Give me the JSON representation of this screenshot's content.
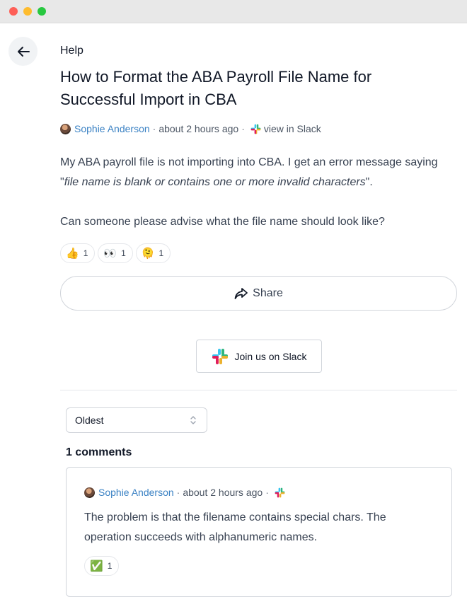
{
  "breadcrumb": "Help",
  "post": {
    "title": "How to Format the ABA Payroll File Name for Successful Import in CBA",
    "author": "Sophie Anderson",
    "separator": "·",
    "time": "about 2 hours ago",
    "slack_link": "view in Slack",
    "body_line1_start": "My ABA payroll file is not importing into CBA. I get an error message saying \"",
    "body_quote": "file name is blank or contains one or more invalid characters",
    "body_line1_end": "\".",
    "body_line2": "Can someone please advise what the file name should look like?",
    "reactions": [
      {
        "emoji": "👍",
        "count": "1",
        "icon": "thumbs-up-icon"
      },
      {
        "emoji": "👀",
        "count": "1",
        "icon": "eyes-icon"
      },
      {
        "emoji": "🫠",
        "count": "1",
        "icon": "melting-face-icon"
      }
    ]
  },
  "share_label": "Share",
  "join_slack_label": "Join us on Slack",
  "sort": {
    "selected": "Oldest"
  },
  "comment_count_label": "1 comments",
  "comment": {
    "author": "Sophie Anderson",
    "separator": "·",
    "time": "about 2 hours ago",
    "text": "The problem is that the filename contains special chars. The operation succeeds with alphanumeric names.",
    "reactions": [
      {
        "emoji": "✅",
        "count": "1",
        "icon": "check-mark-icon"
      }
    ]
  },
  "colors": {
    "link": "#3b82c4",
    "border": "#d1d5db",
    "text": "#374151"
  }
}
